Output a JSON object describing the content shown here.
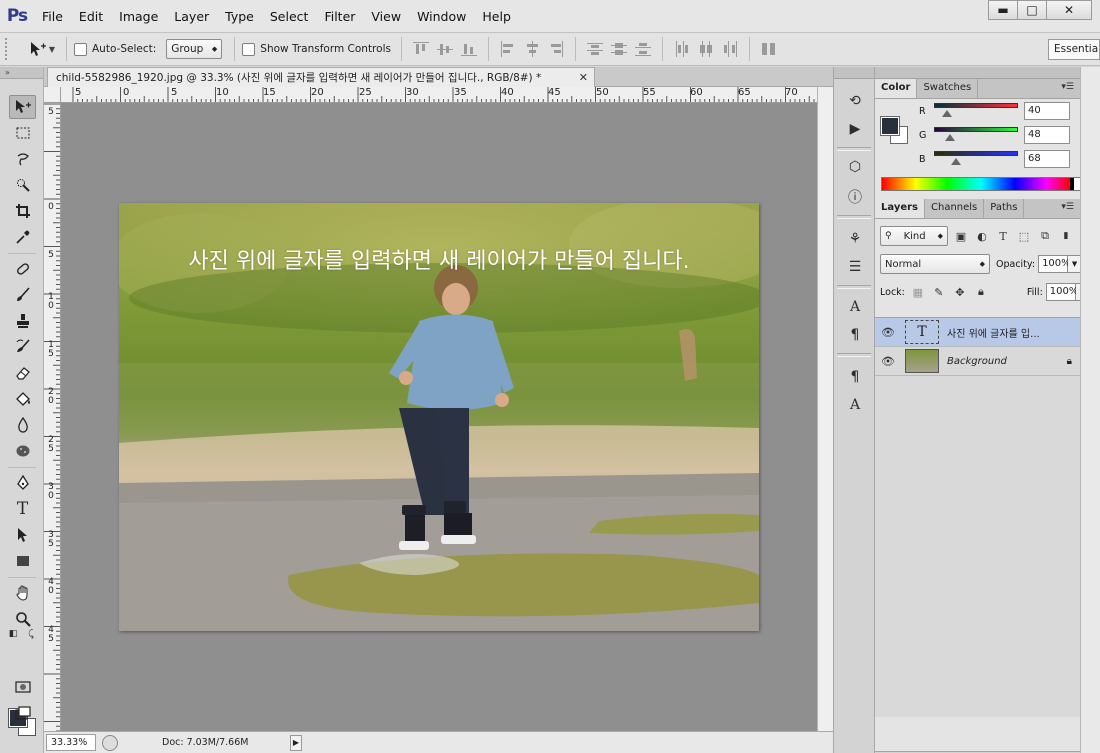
{
  "app": {
    "logo": "Ps"
  },
  "menu": [
    "File",
    "Edit",
    "Image",
    "Layer",
    "Type",
    "Select",
    "Filter",
    "View",
    "Window",
    "Help"
  ],
  "window_controls": {
    "minimize": "▬",
    "maximize": "□",
    "close": "✕"
  },
  "options": {
    "auto_select_label": "Auto-Select:",
    "auto_select_mode": "Group",
    "show_transform_label": "Show Transform Controls",
    "workspace": "Essentials"
  },
  "document": {
    "tab_title": "child-5582986_1920.jpg  @  33.3%  (사진 위에 글자를 입력하면 새 레이어가 만들어 집니다., RGB/8#) *",
    "close": "✕"
  },
  "ruler": {
    "h_labels": [
      "5",
      "0",
      "5",
      "10",
      "15",
      "20",
      "25",
      "30",
      "35",
      "40",
      "45",
      "50",
      "55",
      "60",
      "65",
      "70"
    ],
    "v_labels": [
      "5",
      "0",
      "5",
      "1\n0",
      "1\n5",
      "2\n0",
      "2\n5",
      "3\n0",
      "3\n5",
      "4\n0",
      "4\n5"
    ]
  },
  "canvas": {
    "caption": "사진 위에 글자를 입력하면 새 레이어가 만들어 집니다."
  },
  "status": {
    "zoom": "33.33%",
    "doc": "Doc: 7.03M/7.66M"
  },
  "color_panel": {
    "tabs": [
      "Color",
      "Swatches"
    ],
    "r_label": "R",
    "g_label": "G",
    "b_label": "B",
    "r": "40",
    "g": "48",
    "b": "68",
    "r_level": 0.157,
    "g_level": 0.188,
    "b_level": 0.267,
    "foreground": "#28303d",
    "background": "#ffffff"
  },
  "layers_panel": {
    "tabs": [
      "Layers",
      "Channels",
      "Paths"
    ],
    "filter_kind": "Kind",
    "blend_mode": "Normal",
    "opacity_label": "Opacity:",
    "opacity": "100%",
    "lock_label": "Lock:",
    "fill_label": "Fill:",
    "fill": "100%",
    "layers": [
      {
        "name": "사진 위에 글자를 입...",
        "type": "text",
        "thumb_glyph": "T",
        "selected": true
      },
      {
        "name": "Background",
        "type": "image",
        "locked": true
      }
    ]
  }
}
